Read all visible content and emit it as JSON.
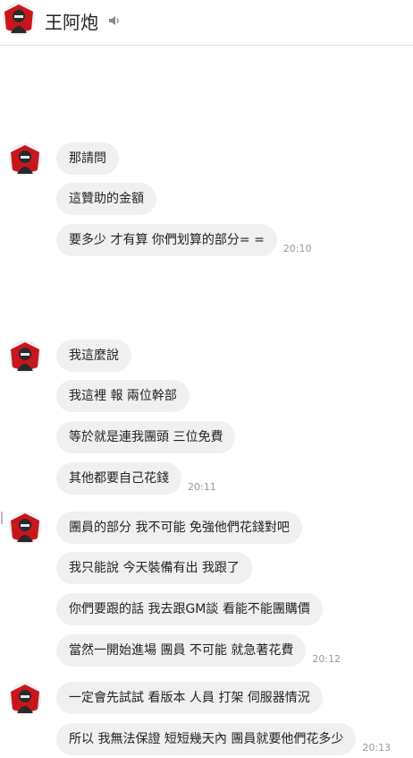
{
  "header": {
    "name": "王阿炮"
  },
  "groups": [
    {
      "messages": [
        {
          "text": "那請問",
          "time": ""
        },
        {
          "text": "這贊助的金額",
          "time": ""
        },
        {
          "text": "要多少 才有算 你們划算的部分= =",
          "time": "20:10"
        }
      ]
    },
    {
      "messages": [
        {
          "text": "我這麼說",
          "time": ""
        },
        {
          "text": "我這裡 報 兩位幹部",
          "time": ""
        },
        {
          "text": "等於就是連我團頭 三位免費",
          "time": ""
        },
        {
          "text": "其他都要自己花錢",
          "time": "20:11"
        }
      ]
    },
    {
      "messages": [
        {
          "text": "團員的部分 我不可能 免強他們花錢對吧",
          "time": ""
        },
        {
          "text": "我只能說 今天裝備有出 我跟了",
          "time": ""
        },
        {
          "text": "你們要跟的話 我去跟GM談 看能不能團購價",
          "time": ""
        },
        {
          "text": "當然一開始進場 團員 不可能 就急著花費",
          "time": "20:12"
        }
      ]
    },
    {
      "messages": [
        {
          "text": "一定會先試試 看版本 人員 打架 伺服器情況",
          "time": ""
        },
        {
          "text": "所以 我無法保證 短短幾天內 團員就要他們花多少",
          "time": "20:13"
        }
      ]
    }
  ]
}
